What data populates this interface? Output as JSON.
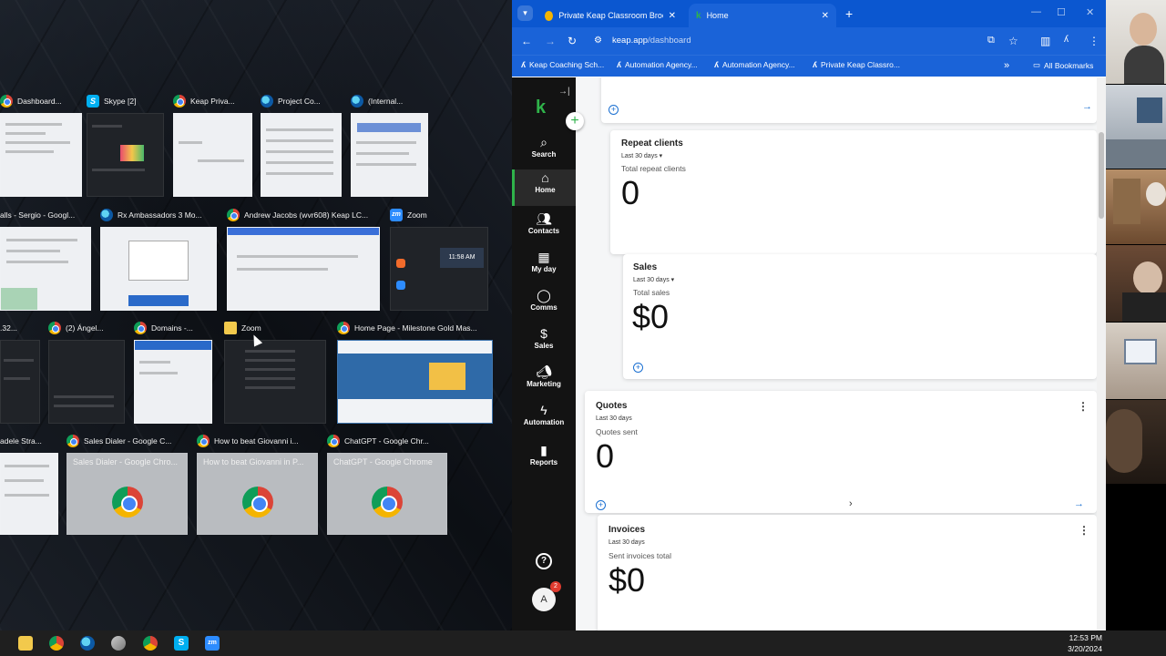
{
  "task_view": {
    "windows": [
      {
        "title": "Dashboard...",
        "icon": "chrome-icon"
      },
      {
        "title": "Skype [2]",
        "icon": "skype-icon"
      },
      {
        "title": "Keap Priva...",
        "icon": "chrome-icon"
      },
      {
        "title": "Project Co...",
        "icon": "edge-icon"
      },
      {
        "title": "(Internal...",
        "icon": "edge-icon"
      },
      {
        "title": "alls - Sergio - Googl...",
        "icon": ""
      },
      {
        "title": "Rx Ambassadors 3 Mo...",
        "icon": "edge-icon"
      },
      {
        "title": "Andrew Jacobs (wvr608) Keap LC...",
        "icon": "chrome-icon"
      },
      {
        "title": "Zoom",
        "icon": "zoom-icon"
      },
      {
        "title": ".32...",
        "icon": ""
      },
      {
        "title": "(2) Ángel...",
        "icon": "chrome-icon"
      },
      {
        "title": "Domains -...",
        "icon": "chrome-icon"
      },
      {
        "title": "Zoom",
        "icon": "folder-icon"
      },
      {
        "title": "Home Page - Milestone Gold Mas...",
        "icon": "chrome-icon"
      },
      {
        "title": "adele Stra...",
        "icon": ""
      },
      {
        "title": "Sales Dialer - Google C...",
        "icon": "chrome-icon"
      },
      {
        "title": "How to beat Giovanni i...",
        "icon": "chrome-icon"
      },
      {
        "title": "ChatGPT - Google Chr...",
        "icon": "chrome-icon"
      }
    ],
    "previews": {
      "sales_dialer": "Sales Dialer - Google Chro...",
      "giovanni": "How to beat Giovanni in P...",
      "chatgpt": "ChatGPT - Google Chrome",
      "zoom_time": "11:58 AM"
    }
  },
  "browser": {
    "tabs": [
      {
        "label": "Private Keap Classroom Brochu..."
      },
      {
        "label": "Home"
      }
    ],
    "url_host": "keap.app",
    "url_path": "/dashboard",
    "bookmarks": [
      "Keap Coaching Sch...",
      "Automation Agency...",
      "Automation Agency...",
      "Private Keap Classro..."
    ],
    "all_bookmarks": "All Bookmarks",
    "more_bookmarks": "»"
  },
  "keap_nav": {
    "logo": "k",
    "items": [
      {
        "label": "Search",
        "icon": "search-icon"
      },
      {
        "label": "Home",
        "icon": "home-icon"
      },
      {
        "label": "Contacts",
        "icon": "contacts-icon"
      },
      {
        "label": "My day",
        "icon": "calendar-icon"
      },
      {
        "label": "Comms",
        "icon": "chat-icon"
      },
      {
        "label": "Sales",
        "icon": "sales-icon"
      },
      {
        "label": "Marketing",
        "icon": "megaphone-icon"
      },
      {
        "label": "Automation",
        "icon": "lightning-icon"
      },
      {
        "label": "Reports",
        "icon": "bar-chart-icon"
      }
    ],
    "avatar": "A",
    "badge": "2",
    "help": "?"
  },
  "dashboard": {
    "repeat_clients": {
      "title": "Repeat clients",
      "period": "Last 30 days ▾",
      "subtitle": "Total repeat clients",
      "value": "0"
    },
    "sales": {
      "title": "Sales",
      "period": "Last 30 days ▾",
      "subtitle": "Total sales",
      "value": "$0"
    },
    "quotes": {
      "title": "Quotes",
      "period": "Last 30 days",
      "subtitle": "Quotes sent",
      "value": "0"
    },
    "invoices": {
      "title": "Invoices",
      "period": "Last 30 days",
      "subtitle": "Sent invoices total",
      "value": "$0"
    }
  },
  "taskbar": {
    "time": "12:53 PM",
    "date": "3/20/2024"
  },
  "colors": {
    "chrome_blue": "#0b57d0",
    "keap_green": "#2fb34a",
    "nav_bg": "#131313",
    "link_blue": "#1a6fd1"
  }
}
